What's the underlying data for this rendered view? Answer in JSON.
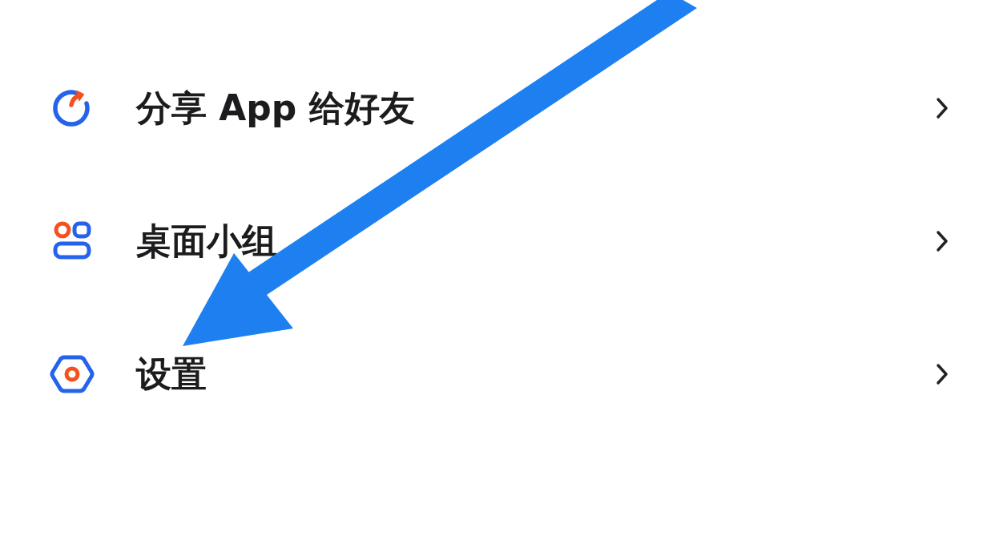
{
  "menu": {
    "items": [
      {
        "kind": "share",
        "label": "分享 App 给好友"
      },
      {
        "kind": "widget",
        "label": "桌面小组"
      },
      {
        "kind": "settings",
        "label": "设置"
      }
    ]
  }
}
